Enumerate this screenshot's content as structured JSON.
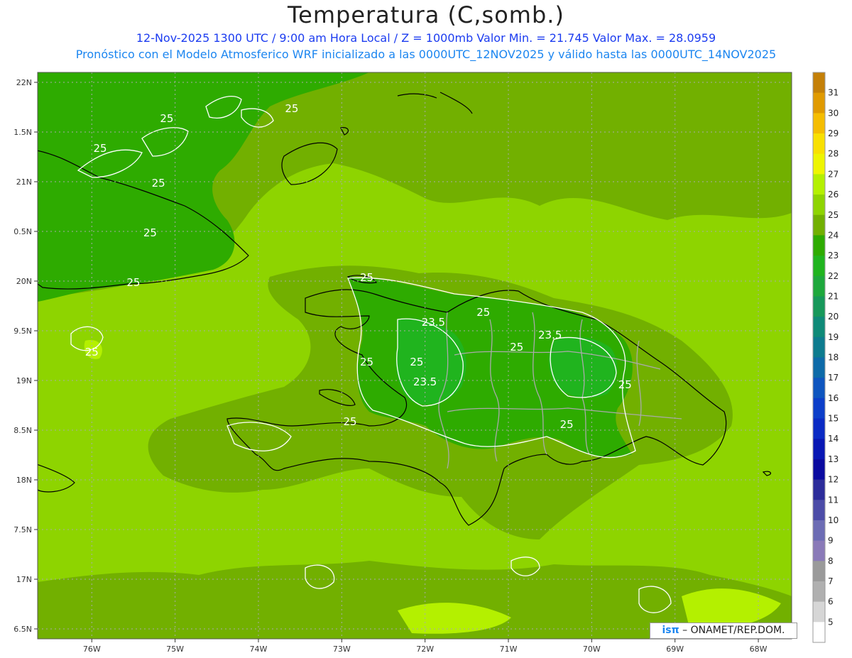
{
  "header": {
    "title": "Temperatura (C,somb.)",
    "line1": "12-Nov-2025  1300 UTC / 9:00 am Hora Local / Z = 1000mb    Valor Min. = 21.745  Valor Max. = 28.0959",
    "line2": "Pronóstico con el Modelo Atmosferico WRF inicializado a las 0000UTC_12NOV2025 y válido hasta las  0000UTC_14NOV2025"
  },
  "axes": {
    "lon_labels": [
      "76W",
      "75W",
      "74W",
      "73W",
      "72W",
      "71W",
      "70W",
      "69W",
      "68W"
    ],
    "lon_values": [
      -76,
      -75,
      -74,
      -73,
      -72,
      -71,
      -70,
      -69,
      -68
    ],
    "lat_labels": [
      "22N",
      "1.5N",
      "21N",
      "0.5N",
      "20N",
      "9.5N",
      "19N",
      "8.5N",
      "18N",
      "7.5N",
      "17N",
      "6.5N"
    ],
    "lat_values": [
      22,
      21.5,
      21,
      20.5,
      20,
      19.5,
      19,
      18.5,
      18,
      17.5,
      17,
      16.5
    ]
  },
  "colorbar": {
    "labels": [
      "31",
      "30",
      "29",
      "28",
      "27",
      "26",
      "25",
      "24",
      "23",
      "22",
      "21",
      "20",
      "19",
      "18",
      "17",
      "16",
      "15",
      "14",
      "13",
      "12",
      "11",
      "10",
      "9",
      "8",
      "7",
      "6",
      "5"
    ],
    "colors": [
      "#c48008",
      "#e09a00",
      "#f5bd00",
      "#f9e000",
      "#eef500",
      "#b4f000",
      "#8ed400",
      "#72b000",
      "#2eab00",
      "#20b41e",
      "#1ea83c",
      "#17985a",
      "#0f8a78",
      "#0d7b8e",
      "#0d6aa8",
      "#0e55bf",
      "#0c3ec9",
      "#0a2ac4",
      "#0817b4",
      "#0a0aa0",
      "#2c2c9a",
      "#4c4ca8",
      "#6c6cb4",
      "#8a7ab8",
      "#9a9a9a",
      "#b0b0b0",
      "#d6d6d6",
      "#ffffff"
    ]
  },
  "contour_labels": [
    {
      "text": "25",
      "lon": -75.9,
      "lat": 21.3
    },
    {
      "text": "25",
      "lon": -75.1,
      "lat": 21.6
    },
    {
      "text": "25",
      "lon": -73.6,
      "lat": 21.7
    },
    {
      "text": "25",
      "lon": -75.2,
      "lat": 20.95
    },
    {
      "text": "25",
      "lon": -75.3,
      "lat": 20.45
    },
    {
      "text": "25",
      "lon": -75.5,
      "lat": 19.95
    },
    {
      "text": "25",
      "lon": -76.0,
      "lat": 19.25
    },
    {
      "text": "25",
      "lon": -72.7,
      "lat": 20.0
    },
    {
      "text": "23.5",
      "lon": -71.9,
      "lat": 19.55
    },
    {
      "text": "25",
      "lon": -72.7,
      "lat": 19.15
    },
    {
      "text": "25",
      "lon": -72.1,
      "lat": 19.15
    },
    {
      "text": "23.5",
      "lon": -72.0,
      "lat": 18.95
    },
    {
      "text": "25",
      "lon": -72.9,
      "lat": 18.55
    },
    {
      "text": "25",
      "lon": -71.3,
      "lat": 19.65
    },
    {
      "text": "23.5",
      "lon": -70.5,
      "lat": 19.42
    },
    {
      "text": "25",
      "lon": -70.9,
      "lat": 19.3
    },
    {
      "text": "25",
      "lon": -69.6,
      "lat": 18.92
    },
    {
      "text": "25",
      "lon": -70.3,
      "lat": 18.52
    }
  ],
  "credit": {
    "logo": "isπ",
    "text": "– ONAMET/REP.DOM."
  }
}
